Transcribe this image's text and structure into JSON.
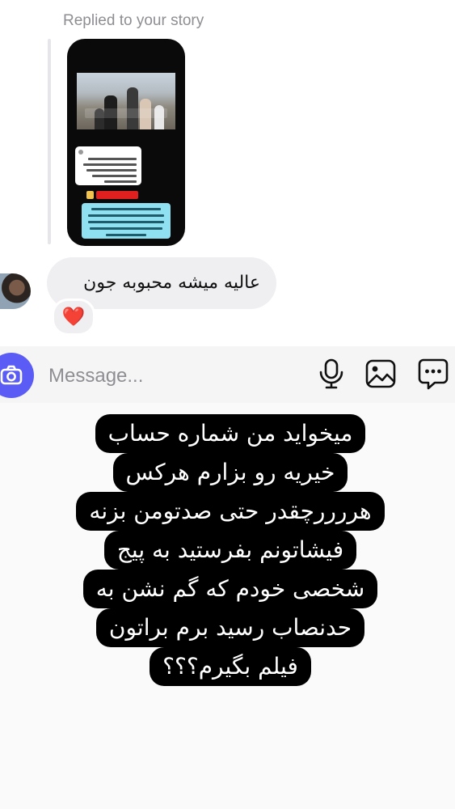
{
  "thread": {
    "reply_label": "Replied to your story",
    "message_text": "عالیه میشه محبوبه جون",
    "reaction": "❤️"
  },
  "composer": {
    "placeholder": "Message...",
    "icons": [
      "camera-icon",
      "microphone-icon",
      "image-icon",
      "sticker-icon"
    ],
    "accent_color": "#5b5bf5"
  },
  "overlay_caption": {
    "lines": [
      "میخواید من شماره حساب",
      "خیریه رو بزارم هرکس",
      "هررررچقدر حتی صدتومن بزنه",
      "فیشاتونم بفرستید به پیج",
      "شخصی خودم که گم نشن به",
      "حدنصاب رسید برم براتون",
      "فیلم بگیرم؟؟؟"
    ]
  }
}
